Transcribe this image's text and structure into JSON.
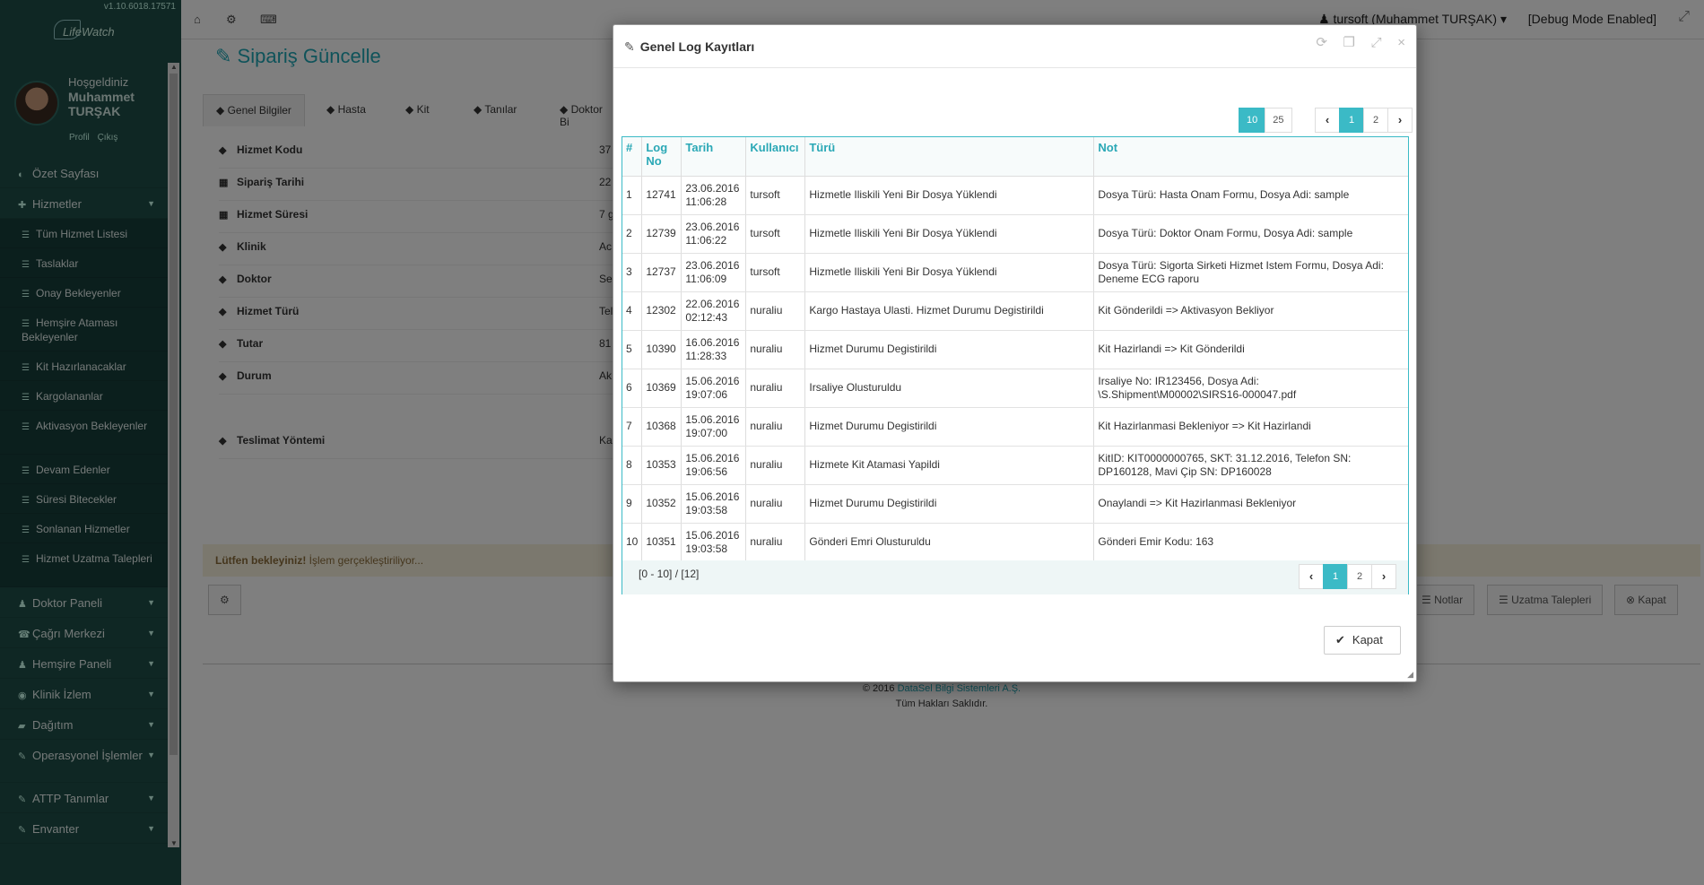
{
  "app": {
    "version": "v1.10.6018.17571",
    "logo_text": "LifeWatch",
    "welcome": "Hoşgeldiniz",
    "user_name": "Muhammet TURŞAK",
    "profile_link": "Profil",
    "logout_link": "Çıkış"
  },
  "sidebar": {
    "items": [
      {
        "label": "Özet Sayfası"
      },
      {
        "label": "Hizmetler"
      },
      {
        "label": "Doktor Paneli"
      },
      {
        "label": "Çağrı Merkezi"
      },
      {
        "label": "Hemşire Paneli"
      },
      {
        "label": "Klinik İzlem"
      },
      {
        "label": "Dağıtım"
      },
      {
        "label": "Operasyonel İşlemler"
      },
      {
        "label": "ATTP Tanımlar"
      },
      {
        "label": "Envanter"
      }
    ],
    "sub_items": [
      {
        "label": "Tüm Hizmet Listesi"
      },
      {
        "label": "Taslaklar"
      },
      {
        "label": "Onay Bekleyenler"
      },
      {
        "label": "Hemşire Ataması Bekleyenler"
      },
      {
        "label": "Kit Hazırlanacaklar"
      },
      {
        "label": "Kargolananlar"
      },
      {
        "label": "Aktivasyon Bekleyenler"
      },
      {
        "label": "Devam Edenler"
      },
      {
        "label": "Süresi Bitecekler"
      },
      {
        "label": "Sonlanan Hizmetler"
      },
      {
        "label": "Hizmet Uzatma Talepleri"
      }
    ]
  },
  "topbar": {
    "user": "tursoft (Muhammet TURŞAK)",
    "debug": "[Debug Mode Enabled]"
  },
  "page": {
    "title": "Sipariş Güncelle",
    "tabs": [
      "Genel Bilgiler",
      "Hasta",
      "Kit",
      "Tanılar",
      "Doktor Bi"
    ],
    "fields": [
      {
        "label": "Hizmet Kodu",
        "value": "37"
      },
      {
        "label": "Sipariş Tarihi",
        "value": "22"
      },
      {
        "label": "Hizmet Süresi",
        "value": "7 g"
      },
      {
        "label": "Klinik",
        "value": "Ac"
      },
      {
        "label": "Doktor",
        "value": "Se"
      },
      {
        "label": "Hizmet Türü",
        "value": "Tel"
      },
      {
        "label": "Tutar",
        "value": "81"
      },
      {
        "label": "Durum",
        "value": "Ak"
      },
      {
        "label": "Teslimat Yöntemi",
        "value": "Ka"
      }
    ],
    "wait_bold": "Lütfen bekleyiniz!",
    "wait_text": " İşlem gerçekleştiriliyor...",
    "footer_buttons": {
      "notes": "Notlar",
      "extension": "Uzatma Talepleri",
      "close": "Kapat"
    },
    "copyright_prefix": "© 2016 ",
    "copyright_link": "DataSel Bilgi Sistemleri A.Ş.",
    "rights": "Tüm Hakları Saklıdır."
  },
  "modal": {
    "title": "Genel Log Kayıtları",
    "page_sizes": [
      "10",
      "25"
    ],
    "pages": [
      "1",
      "2"
    ],
    "columns": [
      "#",
      "Log No",
      "Tarih",
      "Kullanıcı",
      "Türü",
      "Not"
    ],
    "rows": [
      {
        "n": "1",
        "log": "12741",
        "date": "23.06.2016",
        "time": "11:06:28",
        "user": "tursoft",
        "type": "Hizmetle Iliskili Yeni Bir Dosya Yüklendi",
        "note": "Dosya Türü: Hasta Onam Formu, Dosya Adi: sample"
      },
      {
        "n": "2",
        "log": "12739",
        "date": "23.06.2016",
        "time": "11:06:22",
        "user": "tursoft",
        "type": "Hizmetle Iliskili Yeni Bir Dosya Yüklendi",
        "note": "Dosya Türü: Doktor Onam Formu, Dosya Adi: sample"
      },
      {
        "n": "3",
        "log": "12737",
        "date": "23.06.2016",
        "time": "11:06:09",
        "user": "tursoft",
        "type": "Hizmetle Iliskili Yeni Bir Dosya Yüklendi",
        "note": "Dosya Türü: Sigorta Sirketi Hizmet Istem Formu, Dosya Adi: Deneme ECG raporu"
      },
      {
        "n": "4",
        "log": "12302",
        "date": "22.06.2016",
        "time": "02:12:43",
        "user": "nuraliu",
        "type": "Kargo Hastaya Ulasti. Hizmet Durumu Degistirildi",
        "note": "Kit Gönderildi => Aktivasyon Bekliyor"
      },
      {
        "n": "5",
        "log": "10390",
        "date": "16.06.2016",
        "time": "11:28:33",
        "user": "nuraliu",
        "type": "Hizmet Durumu Degistirildi",
        "note": "Kit Hazirlandi => Kit Gönderildi"
      },
      {
        "n": "6",
        "log": "10369",
        "date": "15.06.2016",
        "time": "19:07:06",
        "user": "nuraliu",
        "type": "Irsaliye Olusturuldu",
        "note": "Irsaliye No: IR123456, Dosya Adi: \\S.Shipment\\M00002\\SIRS16-000047.pdf"
      },
      {
        "n": "7",
        "log": "10368",
        "date": "15.06.2016",
        "time": "19:07:00",
        "user": "nuraliu",
        "type": "Hizmet Durumu Degistirildi",
        "note": "Kit Hazirlanmasi Bekleniyor => Kit Hazirlandi"
      },
      {
        "n": "8",
        "log": "10353",
        "date": "15.06.2016",
        "time": "19:06:56",
        "user": "nuraliu",
        "type": "Hizmete Kit Atamasi Yapildi",
        "note": "KitID: KIT0000000765, SKT: 31.12.2016, Telefon SN: DP160128, Mavi Çip SN: DP160028"
      },
      {
        "n": "9",
        "log": "10352",
        "date": "15.06.2016",
        "time": "19:03:58",
        "user": "nuraliu",
        "type": "Hizmet Durumu Degistirildi",
        "note": "Onaylandi => Kit Hazirlanmasi Bekleniyor"
      },
      {
        "n": "10",
        "log": "10351",
        "date": "15.06.2016",
        "time": "19:03:58",
        "user": "nuraliu",
        "type": "Gönderi Emri Olusturuldu",
        "note": "Gönderi Emir Kodu: 163"
      }
    ],
    "range_text": "[0 - 10] / [12]",
    "close_label": "Kapat"
  }
}
